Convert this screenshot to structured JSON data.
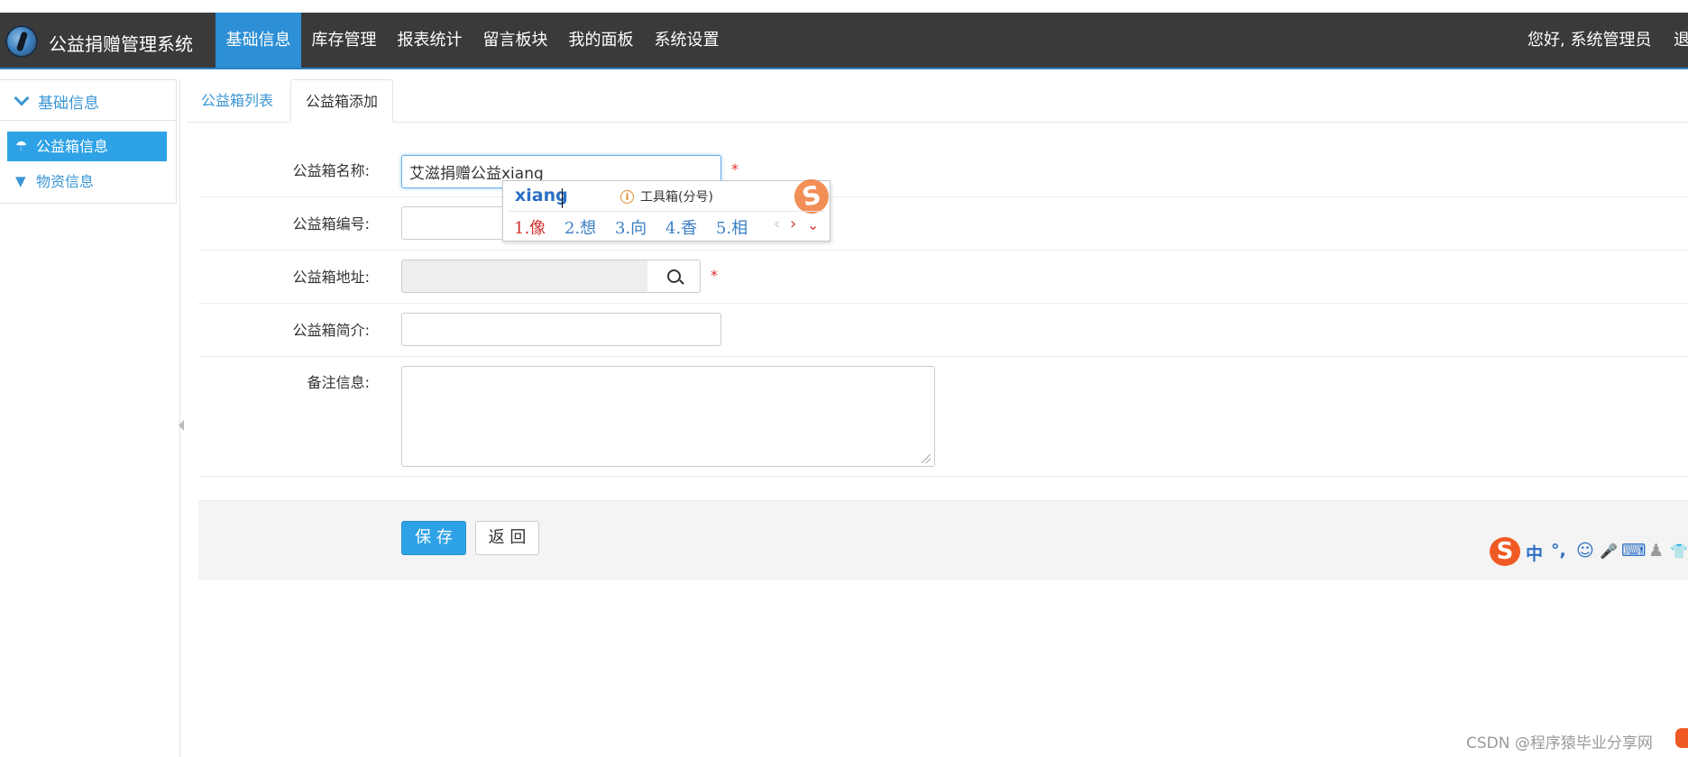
{
  "app": {
    "title": "公益捐赠管理系统"
  },
  "nav": {
    "items": [
      {
        "label": "基础信息",
        "active": true
      },
      {
        "label": "库存管理"
      },
      {
        "label": "报表统计"
      },
      {
        "label": "留言板块"
      },
      {
        "label": "我的面板"
      },
      {
        "label": "系统设置"
      }
    ],
    "greeting": "您好, 系统管理员",
    "logout": "退"
  },
  "sidebar": {
    "header": "基础信息",
    "items": [
      {
        "label": "公益箱信息",
        "icon": "umbrella-icon",
        "active": true
      },
      {
        "label": "物资信息",
        "icon": "filter-icon"
      }
    ]
  },
  "tabs": [
    {
      "label": "公益箱列表"
    },
    {
      "label": "公益箱添加",
      "active": true
    }
  ],
  "form": {
    "name": {
      "label": "公益箱名称:",
      "value": "艾滋捐赠公益xiang",
      "required": "*"
    },
    "code": {
      "label": "公益箱编号:",
      "value": ""
    },
    "address": {
      "label": "公益箱地址:",
      "value": "",
      "required": "*"
    },
    "intro": {
      "label": "公益箱简介:",
      "value": ""
    },
    "remark": {
      "label": "备注信息:",
      "value": ""
    }
  },
  "buttons": {
    "save": "保 存",
    "back": "返 回"
  },
  "ime": {
    "composition": "xiang",
    "tip_icon": "i",
    "tip": "工具箱(分号)",
    "candidates": [
      "1.像",
      "2.想",
      "3.向",
      "4.香",
      "5.相"
    ],
    "nav_prev": "‹",
    "nav_next": "›",
    "nav_more": "⌄",
    "logo": "S"
  },
  "ime_toolbar": {
    "logo": "S",
    "items": [
      "中",
      "°,",
      "☺",
      "🎤",
      "⌨",
      "♟",
      "👕"
    ]
  },
  "watermark": "CSDN @程序猿毕业分享网",
  "colors": {
    "accent": "#2ea2e6",
    "navbar": "#3a3a3a",
    "required": "#e03030"
  }
}
